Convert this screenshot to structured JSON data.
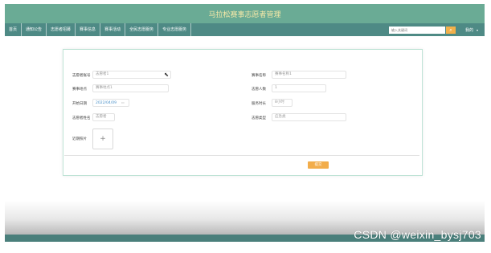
{
  "header": {
    "title": "马拉松赛事志愿者管理"
  },
  "nav": {
    "items": [
      "首页",
      "通知公告",
      "志愿者招募",
      "赛事信息",
      "赛事活动",
      "全民志愿服务",
      "专业志愿服务"
    ],
    "search_placeholder": "输入关键词",
    "search_icon": "search-icon",
    "user_label": "我的"
  },
  "form": {
    "fields": [
      {
        "label": "志愿者账号",
        "value": "志愿者1"
      },
      {
        "label": "赛事名称",
        "value": "赛事名称1"
      },
      {
        "label": "赛事地点",
        "value": "赛事地点1"
      },
      {
        "label": "志愿人数",
        "value": "1"
      },
      {
        "label": "开始日期",
        "value": "2022/04/09"
      },
      {
        "label": "服务时长",
        "value": "8小时"
      },
      {
        "label": "志愿类型",
        "value": "应急类"
      },
      {
        "label": "志愿者姓名",
        "value": "志愿者"
      },
      {
        "label": "近期照片",
        "value": "+"
      }
    ],
    "submit_label": "提交"
  },
  "watermark": "CSDN @weixin_bysj703",
  "colors": {
    "header": "#6aab95",
    "nav": "#4e8a85",
    "accent": "#f2ad4b"
  }
}
